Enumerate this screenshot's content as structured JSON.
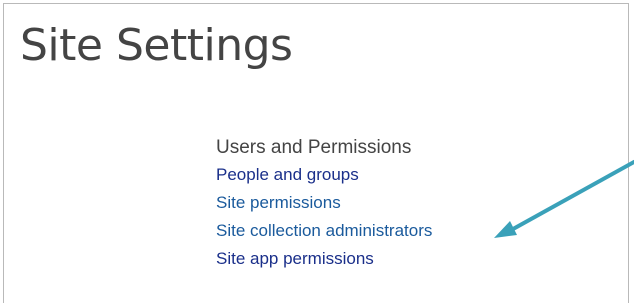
{
  "page": {
    "title": "Site Settings"
  },
  "sections": {
    "users_permissions": {
      "heading": "Users and Permissions",
      "links": [
        {
          "label": "People and groups"
        },
        {
          "label": "Site permissions"
        },
        {
          "label": "Site collection administrators"
        },
        {
          "label": "Site app permissions"
        }
      ]
    }
  },
  "annotation": {
    "arrow_color": "#3aa1b9",
    "points_to": "Site collection administrators"
  },
  "colors": {
    "title_text": "#444444",
    "link": "#1a5a9c",
    "link_dark": "#1a2f8a",
    "frame_border": "#b9b9b9"
  }
}
